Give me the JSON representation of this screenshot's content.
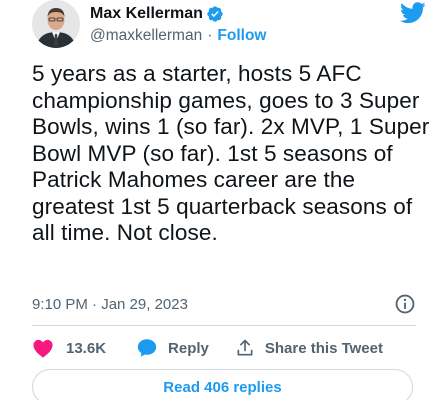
{
  "author": {
    "display_name": "Max Kellerman",
    "handle": "@maxkellerman",
    "separator": "·",
    "follow_label": "Follow",
    "verified": true
  },
  "tweet": {
    "text": "5 years as a starter, hosts 5 AFC championship games, goes to 3 Super Bowls, wins 1 (so far). 2x MVP, 1 Super Bowl MVP (so far). 1st 5 seasons of Patrick Mahomes career are the greatest 1st 5 quarterback seasons of all time. Not close.",
    "timestamp": "9:10 PM · Jan 29, 2023"
  },
  "actions": {
    "like_count": "13.6K",
    "reply_label": "Reply",
    "share_label": "Share this Tweet"
  },
  "replies_button": {
    "label": "Read 406 replies"
  },
  "colors": {
    "accent": "#1d9bf0",
    "like": "#f91880",
    "text_primary": "#0f1419",
    "text_secondary": "#536471",
    "border": "#cfd9de"
  },
  "icons": {
    "verified": "verified-badge-icon",
    "logo": "twitter-bird-icon",
    "info": "info-icon",
    "like": "heart-icon",
    "reply": "speech-bubble-icon",
    "share": "share-upload-icon"
  }
}
